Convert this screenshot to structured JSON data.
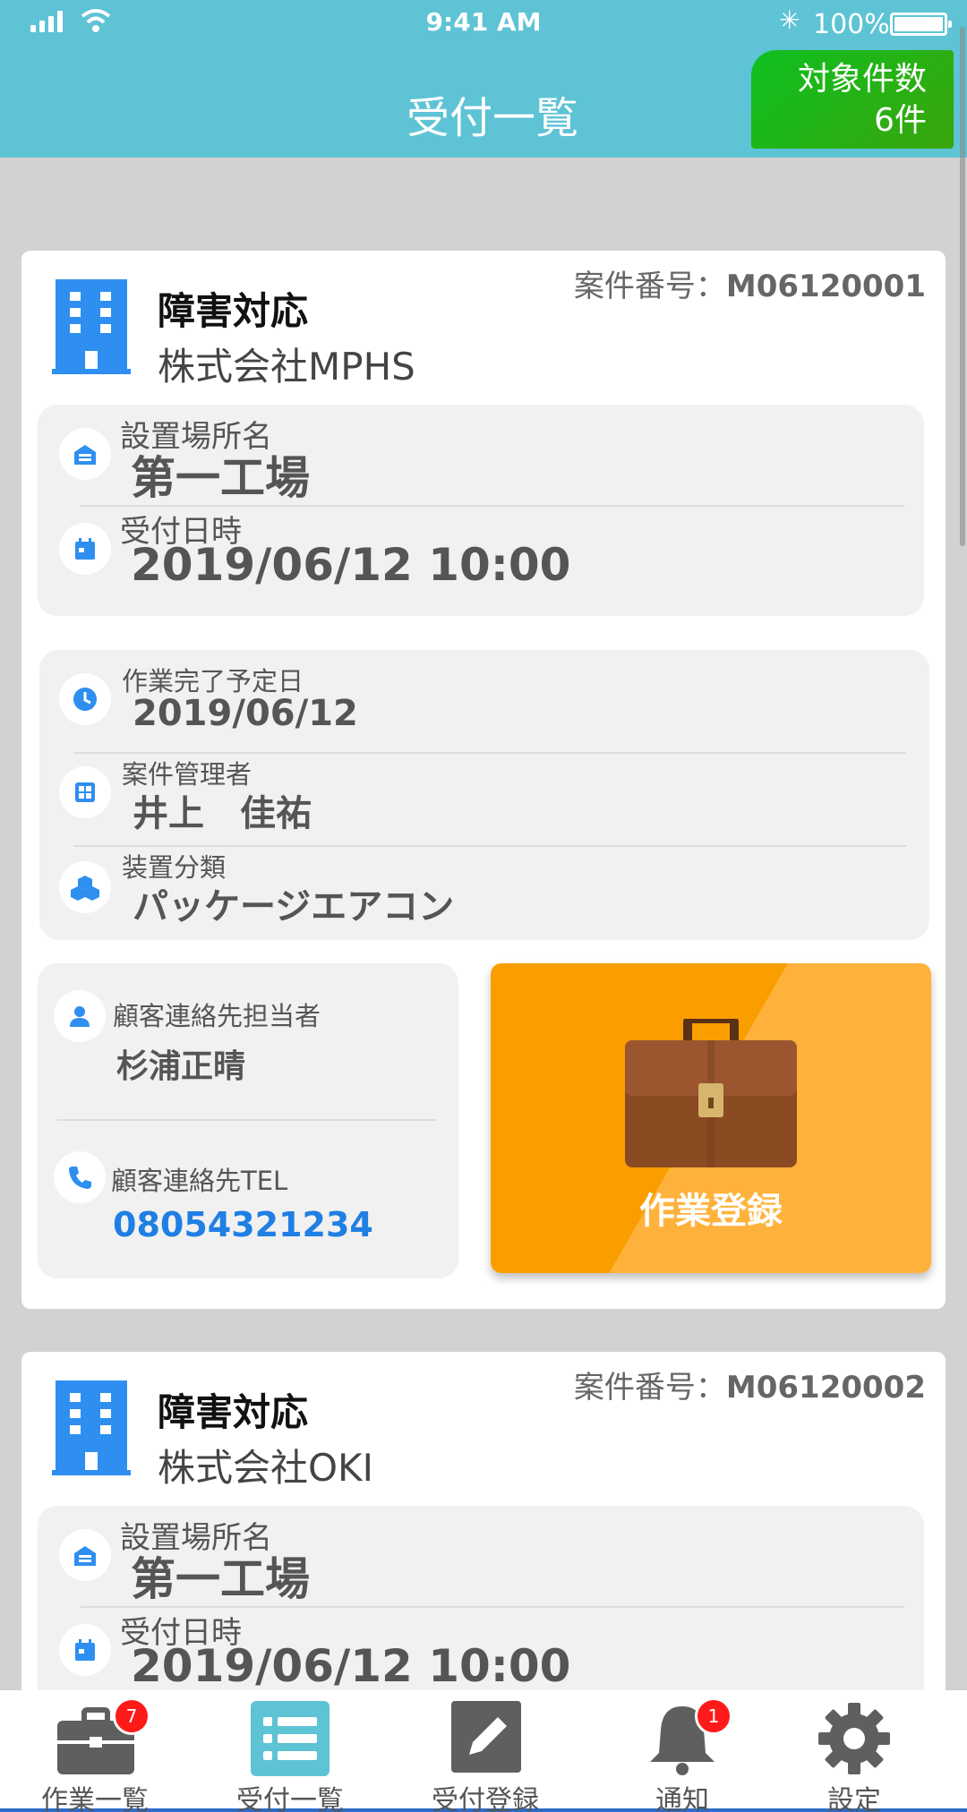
{
  "status_bar": {
    "time": "9:41 AM",
    "battery": "100%"
  },
  "header": {
    "title": "受付一覧",
    "count_label": "対象件数",
    "count_value": "6件"
  },
  "labels": {
    "case_number": "案件番号：",
    "site": "設置場所名",
    "received": "受付日時",
    "due": "作業完了予定日",
    "manager": "案件管理者",
    "device": "装置分類",
    "contact_person": "顧客連絡先担当者",
    "contact_tel": "顧客連絡先TEL",
    "action": "作業登録"
  },
  "cards": [
    {
      "case_number": "M06120001",
      "case_type": "障害対応",
      "company": "株式会社MPHS",
      "site": "第一工場",
      "received": "2019/06/12 10:00",
      "due": "2019/06/12",
      "manager": "井上　佳祐",
      "device": "パッケージエアコン",
      "contact_person": "杉浦正晴",
      "contact_tel": "08054321234"
    },
    {
      "case_number": "M06120002",
      "case_type": "障害対応",
      "company": "株式会社OKI",
      "site": "第一工場",
      "received": "2019/06/12 10:00"
    }
  ],
  "tabbar": [
    {
      "label": "作業一覧",
      "icon": "briefcase-icon",
      "badge": "7"
    },
    {
      "label": "受付一覧",
      "icon": "list-icon"
    },
    {
      "label": "受付登録",
      "icon": "pencil-icon"
    },
    {
      "label": "通知",
      "icon": "bell-icon",
      "badge": "1"
    },
    {
      "label": "設定",
      "icon": "gear-icon"
    }
  ],
  "colors": {
    "header": "#5ec3d5",
    "accent_blue": "#2f8ff0",
    "count_badge": "#1ab31a",
    "action_orange": "#fa9e00",
    "tel": "#1f7fe3",
    "badge_red": "#ff1a1a"
  }
}
